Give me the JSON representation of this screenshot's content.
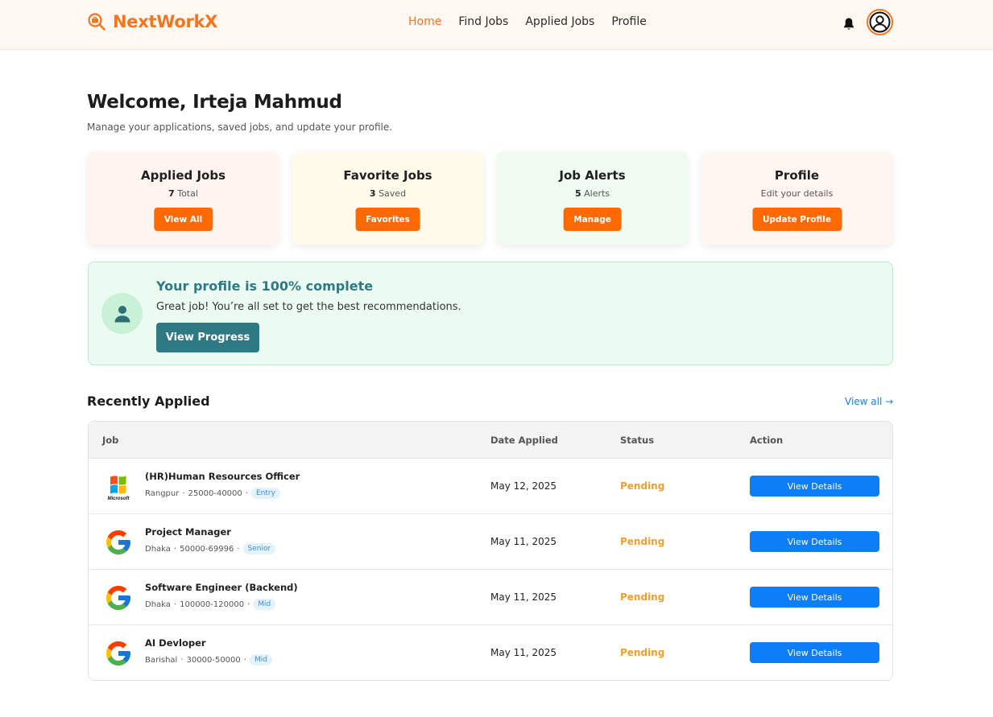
{
  "header": {
    "brand": "NextWorkX",
    "brand_color": "#f4751f",
    "nav": [
      {
        "label": "Home",
        "active": true
      },
      {
        "label": "Find Jobs",
        "active": false
      },
      {
        "label": "Applied Jobs",
        "active": false
      },
      {
        "label": "Profile",
        "active": false
      }
    ],
    "icons": [
      "bell-icon",
      "user-avatar-icon"
    ]
  },
  "welcome": {
    "title": "Welcome, Irteja Mahmud",
    "subtitle": "Manage your applications, saved jobs, and update your profile."
  },
  "cards": [
    {
      "title": "Applied Jobs",
      "count": "7",
      "suffix": "Total",
      "button": "View All",
      "bg": "#fff4ef"
    },
    {
      "title": "Favorite Jobs",
      "count": "3",
      "suffix": "Saved",
      "button": "Favorites",
      "bg": "#fffaea"
    },
    {
      "title": "Job Alerts",
      "count": "5",
      "suffix": "Alerts",
      "button": "Manage",
      "bg": "#effbf1"
    },
    {
      "title": "Profile",
      "count": "",
      "suffix": "Edit your details",
      "button": "Update Profile",
      "bg": "#fff6f2"
    }
  ],
  "profile_banner": {
    "title": "Your profile is 100% complete",
    "text": "Great job! You’re all set to get the best recommendations.",
    "button": "View Progress",
    "completion_percent": 100
  },
  "recent": {
    "title": "Recently Applied",
    "view_all": "View all →",
    "columns": [
      "Job",
      "Date Applied",
      "Status",
      "Action"
    ],
    "rows": [
      {
        "company_logo": "microsoft-logo",
        "title": "(HR)Human Resources Officer",
        "location": "Rangpur",
        "salary": "25000-40000",
        "level": "Entry",
        "date": "May 12, 2025",
        "status": "Pending",
        "action": "View Details"
      },
      {
        "company_logo": "google-logo",
        "title": "Project Manager",
        "location": "Dhaka",
        "salary": "50000-69996",
        "level": "Senior",
        "date": "May 11, 2025",
        "status": "Pending",
        "action": "View Details"
      },
      {
        "company_logo": "google-logo",
        "title": "Software Engineer (Backend)",
        "location": "Dhaka",
        "salary": "100000-120000",
        "level": "Mid",
        "date": "May 11, 2025",
        "status": "Pending",
        "action": "View Details"
      },
      {
        "company_logo": "google-logo",
        "title": "AI Devloper",
        "location": "Barishal",
        "salary": "30000-50000",
        "level": "Mid",
        "date": "May 11, 2025",
        "status": "Pending",
        "action": "View Details"
      }
    ]
  }
}
